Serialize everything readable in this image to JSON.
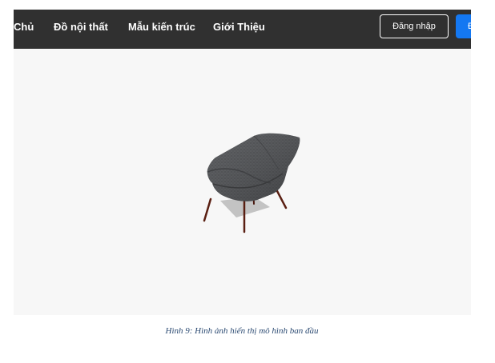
{
  "navbar": {
    "items": [
      {
        "label": "Chủ"
      },
      {
        "label": "Đồ nội thất"
      },
      {
        "label": "Mẫu kiến trúc"
      },
      {
        "label": "Giới Thiệu"
      }
    ],
    "login_label": "Đăng nhập",
    "register_label": "Đ",
    "background_color": "#303030",
    "register_color": "#1478f2"
  },
  "viewer": {
    "model_description_icon": "armchair-3d-model",
    "background_color": "#f7f7f7"
  },
  "caption": {
    "text": "Hình 9: Hình ảnh hiển thị mô hình ban đầu"
  }
}
